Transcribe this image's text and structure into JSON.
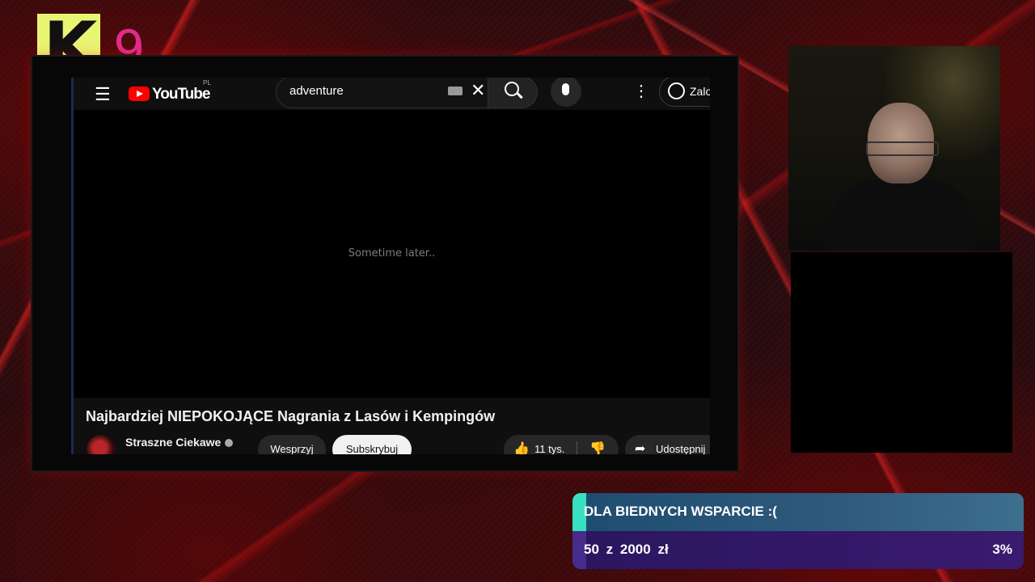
{
  "brand": {
    "logo_letter": "K",
    "logo_number": "9"
  },
  "youtube": {
    "logo_text": "YouTube",
    "region": "PL",
    "search": {
      "value": "adventure"
    },
    "signin_label": "Zalo"
  },
  "video": {
    "overlay_text": "Sometime later..",
    "title": "Najbardziej NIEPOKOJĄCE Nagrania z Lasów i Kempingów",
    "channel": "Straszne Ciekawe",
    "join_label": "Wesprzyj",
    "subscribe_label": "Subskrybuj",
    "likes": "11 tys.",
    "share_label": "Udostępnij"
  },
  "donation": {
    "title": "DLA BIEDNYCH WSPARCIE :(",
    "current": "50",
    "separator": "z",
    "goal": "2000",
    "currency": "zł",
    "percent_label": "3%",
    "progress_fraction": 0.03
  },
  "colors": {
    "accent_teal": "#38e0c0",
    "youtube_red": "#ff0000",
    "logo_yellow": "#e8f572",
    "logo_pink": "#e02b8c"
  },
  "icons": {
    "menu": "hamburger-icon",
    "search": "search-icon",
    "mic": "mic-icon",
    "more": "more-vert-icon",
    "user": "user-circle-icon",
    "like": "thumb-up-icon",
    "dislike": "thumb-down-icon",
    "share": "share-icon"
  }
}
